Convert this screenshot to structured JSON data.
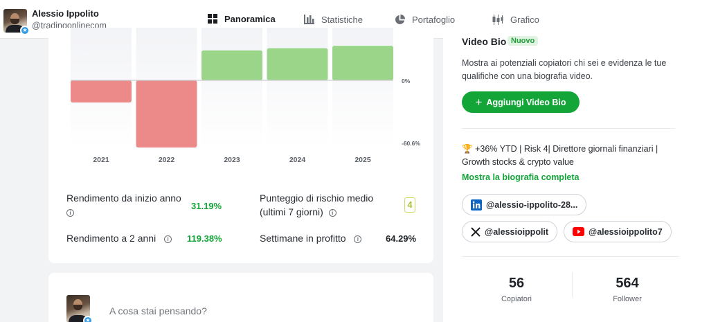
{
  "profile": {
    "name": "Alessio Ippolito",
    "handle": "@tradingonlinecom"
  },
  "tabs": [
    {
      "label": "Panoramica",
      "icon": "grid-icon",
      "active": true
    },
    {
      "label": "Statistiche",
      "icon": "bar-chart-icon",
      "active": false
    },
    {
      "label": "Portafoglio",
      "icon": "pie-chart-icon",
      "active": false
    },
    {
      "label": "Grafico",
      "icon": "candlestick-icon",
      "active": false
    }
  ],
  "chart_data": {
    "type": "bar",
    "categories": [
      "2021",
      "2022",
      "2023",
      "2024",
      "2025"
    ],
    "values": [
      -20,
      -60.6,
      27,
      29,
      31.19
    ],
    "y_tick_labels": [
      "0%",
      "-60.6%"
    ],
    "ylim": [
      -60.6,
      33
    ],
    "colors": {
      "positive": "#9ad58a",
      "negative": "#ec8a8a"
    },
    "grid": false
  },
  "metrics": {
    "ytd_label": "Rendimento da inizio anno",
    "ytd_value": "31.19%",
    "two_year_label": "Rendimento a 2 anni",
    "two_year_value": "119.38%",
    "risk_label_line1": "Punteggio di rischio medio",
    "risk_label_line2": "(ultimi 7 giorni)",
    "risk_value": "4",
    "profit_weeks_label": "Settimane in profitto",
    "profit_weeks_value": "64.29%"
  },
  "post": {
    "placeholder": "A cosa stai pensando?"
  },
  "sidebar": {
    "video_title": "Video Bio",
    "new_badge": "Nuovo",
    "video_desc": "Mostra ai potenziali copiatori chi sei e evidenza le tue qualifiche con una biografia video.",
    "add_video_label": "Aggiungi Video Bio",
    "bio_text": "+36% YTD | Risk 4| Direttore giornali finanziari | Growth stocks & crypto value",
    "bio_emoji": "🏆",
    "bio_link": "Mostra la biografia completa",
    "links": [
      {
        "label": "@alessio-ippolito-28...",
        "icon": "linkedin-icon"
      },
      {
        "label": "@alessioippolit",
        "icon": "x-icon"
      },
      {
        "label": "@alessioippolito7",
        "icon": "youtube-icon"
      }
    ],
    "copiers_count": "56",
    "copiers_label": "Copiatori",
    "followers_count": "564",
    "followers_label": "Follower"
  },
  "colors": {
    "accent_green": "#13a538",
    "risk_box": "#c7dd6a"
  }
}
